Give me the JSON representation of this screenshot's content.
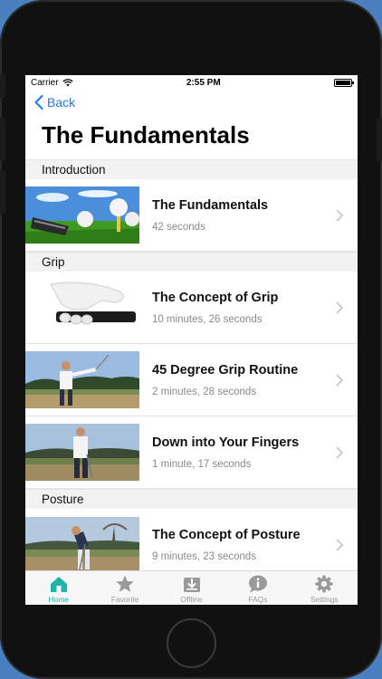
{
  "status": {
    "carrier": "Carrier",
    "time": "2:55 PM"
  },
  "nav": {
    "back_label": "Back",
    "title": "The Fundamentals"
  },
  "sections": [
    {
      "header": "Introduction",
      "rows": [
        {
          "title": "The Fundamentals",
          "subtitle": "42 seconds",
          "thumb": "golf-ball-on-tee"
        }
      ]
    },
    {
      "header": "Grip",
      "rows": [
        {
          "title": "The Concept of Grip",
          "subtitle": "10 minutes, 26 seconds",
          "thumb": "gloved-hand-grip"
        },
        {
          "title": "45 Degree Grip Routine",
          "subtitle": "2 minutes, 28 seconds",
          "thumb": "golfer-raising-club"
        },
        {
          "title": "Down into Your Fingers",
          "subtitle": "1 minute, 17 seconds",
          "thumb": "golfer-standing"
        }
      ]
    },
    {
      "header": "Posture",
      "rows": [
        {
          "title": "The Concept of Posture",
          "subtitle": "9 minutes, 23 seconds",
          "thumb": "golfer-posture"
        }
      ]
    }
  ],
  "tabs": [
    {
      "label": "Home",
      "icon": "home-icon",
      "active": true
    },
    {
      "label": "Favorite",
      "icon": "star-icon",
      "active": false
    },
    {
      "label": "Offline",
      "icon": "download-icon",
      "active": false
    },
    {
      "label": "FAQs",
      "icon": "info-bubble-icon",
      "active": false
    },
    {
      "label": "Settings",
      "icon": "gear-icon",
      "active": false
    }
  ],
  "colors": {
    "accent": "#1a7cf0",
    "tab_active": "#1fb5a8",
    "tab_inactive": "#9a9a9a"
  }
}
